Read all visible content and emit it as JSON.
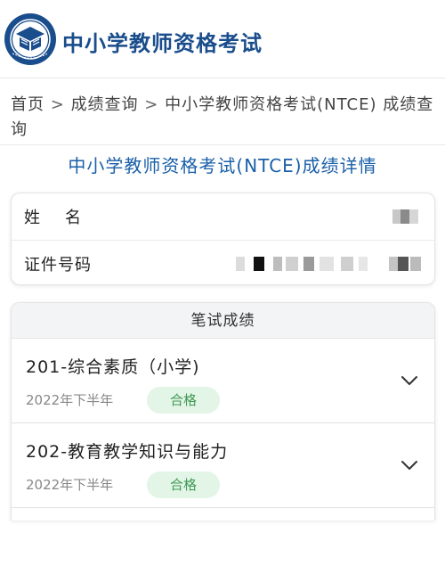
{
  "header": {
    "logo_icon": "ntce-logo-emblem",
    "site_title": "中小学教师资格考试"
  },
  "breadcrumb": {
    "items": [
      "首页",
      "成绩查询",
      "中小学教师资格考试(NTCE) 成绩查询"
    ],
    "separator": ">"
  },
  "page_title": "中小学教师资格考试(NTCE)成绩详情",
  "info": {
    "name_label": "姓名",
    "id_label": "证件号码"
  },
  "scores": {
    "section_title": "笔试成绩",
    "subjects": [
      {
        "name": "201-综合素质（小学)",
        "term": "2022年下半年",
        "status": "合格",
        "icon": "chevron-down-icon"
      },
      {
        "name": "202-教育教学知识与能力",
        "term": "2022年下半年",
        "status": "合格",
        "icon": "chevron-down-icon"
      }
    ]
  },
  "colors": {
    "brand_blue": "#1a4d8c",
    "title_blue": "#1a5fa8",
    "pass_bg": "#e3f5e6",
    "pass_text": "#3f9a55"
  }
}
